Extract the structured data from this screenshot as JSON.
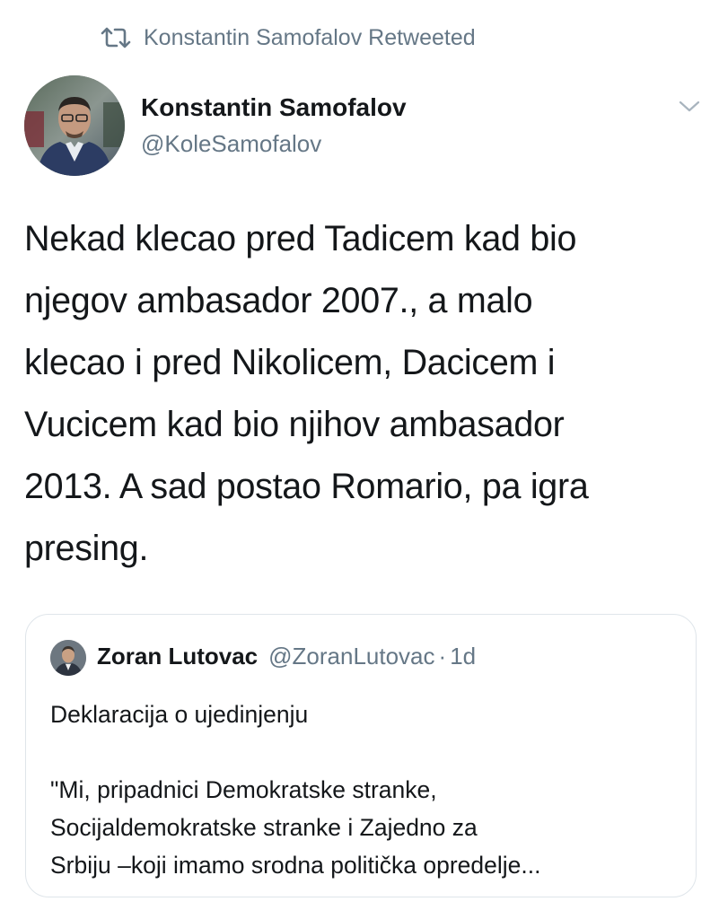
{
  "retweet": {
    "icon": "retweet-icon",
    "label": "Konstantin Samofalov Retweeted"
  },
  "author": {
    "name": "Konstantin Samofalov",
    "handle": "@KoleSamofalov",
    "avatar_icon": "profile-photo"
  },
  "menu": {
    "icon": "chevron-down-icon"
  },
  "tweet": {
    "lines": [
      "Nekad klecao pred Tadicem kad bio",
      "njegov ambasador 2007., a malo",
      "klecao i pred Nikolicem, Dacicem i",
      "Vucicem kad bio njihov ambasador",
      "2013. A sad postao Romario, pa igra",
      "presing."
    ]
  },
  "quote": {
    "name": "Zoran Lutovac",
    "handle": "@ZoranLutovac",
    "separator": "·",
    "time": "1d",
    "body_lines": [
      "Deklaracija o ujedinjenju",
      "\"Mi, pripadnici Demokratske stranke,",
      "Socijaldemokratske stranke i Zajedno za",
      "Srbiju –koji imamo srodna politička opredelje..."
    ]
  },
  "colors": {
    "text": "#14171a",
    "secondary": "#657786",
    "border": "#dfe5ea"
  }
}
